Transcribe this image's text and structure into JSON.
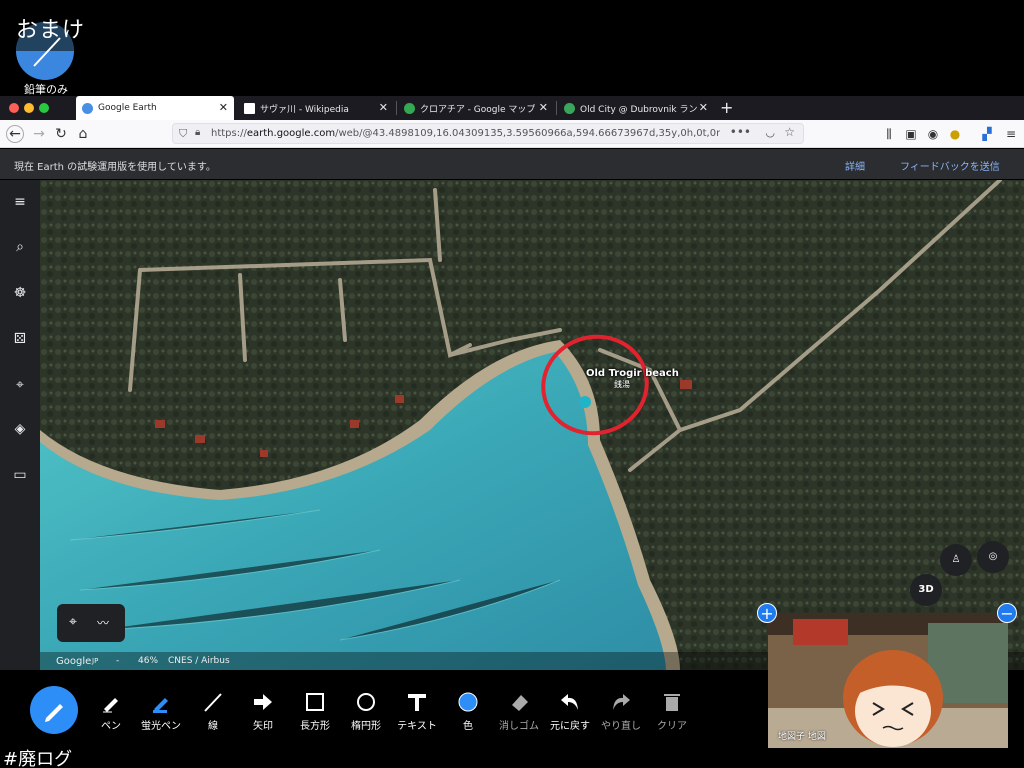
{
  "overlay": {
    "title": "おまけ",
    "mode_label": "鉛筆のみ",
    "hashtag": "#廃ログ"
  },
  "browser": {
    "tabs": [
      {
        "title": "Google Earth",
        "icon": "google-earth-icon",
        "active": true
      },
      {
        "title": "サヴァ川 - Wikipedia",
        "icon": "wikipedia-icon",
        "active": false
      },
      {
        "title": "クロアチア - Google マップ",
        "icon": "google-maps-icon",
        "active": false
      },
      {
        "title": "Old City @ Dubrovnik ランニン",
        "icon": "route-icon",
        "active": false
      }
    ],
    "url_prefix": "https://",
    "url_host": "earth.google.com",
    "url_rest": "/web/@43.4898109,16.04309135,3.59560966a,594.66673967d,35y,0h,0t,0r"
  },
  "earth": {
    "notice": "現在 Earth の試験運用版を使用しています。",
    "details_link": "詳細",
    "feedback_link": "フィードバックを送信",
    "place_name": "Old Trogir beach",
    "place_sub": "銭湯",
    "button_3d": "3D",
    "attribution": {
      "logo": "Google",
      "logo_suffix": "JP",
      "dash": "-",
      "zoom": "46%",
      "credits": "CNES / Airbus"
    }
  },
  "toolbar": {
    "tools": [
      {
        "label": "ペン",
        "icon": "pen-icon"
      },
      {
        "label": "蛍光ペン",
        "icon": "highlighter-icon"
      },
      {
        "label": "線",
        "icon": "line-icon"
      },
      {
        "label": "矢印",
        "icon": "arrow-icon"
      },
      {
        "label": "長方形",
        "icon": "rectangle-icon"
      },
      {
        "label": "楕円形",
        "icon": "ellipse-icon"
      },
      {
        "label": "テキスト",
        "icon": "text-icon"
      },
      {
        "label": "色",
        "icon": "color-icon"
      },
      {
        "label": "消しゴム",
        "icon": "eraser-icon"
      },
      {
        "label": "元に戻す",
        "icon": "undo-icon"
      },
      {
        "label": "やり直し",
        "icon": "redo-icon"
      },
      {
        "label": "クリア",
        "icon": "trash-icon"
      }
    ],
    "selected_color": "#2e8ef7"
  },
  "webcam": {
    "label": "地図子 地図"
  },
  "colors": {
    "accent": "#2e8ef7",
    "annotation_red": "#e0232e",
    "water": "#3fb3bf"
  }
}
